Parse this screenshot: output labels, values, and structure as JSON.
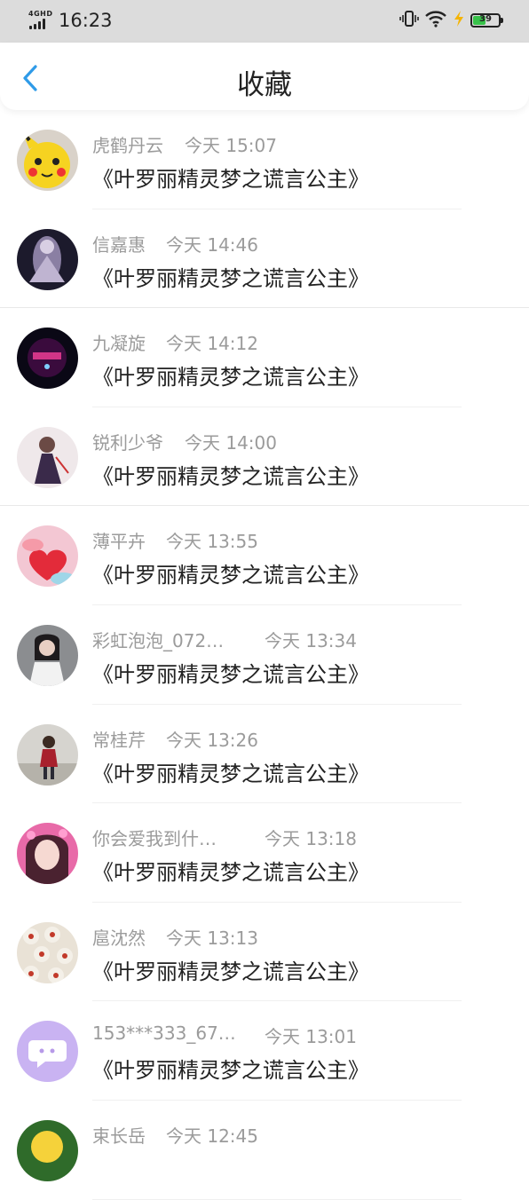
{
  "status_bar": {
    "network": "4GHD",
    "time": "16:23",
    "battery": "39",
    "icons": [
      "signal-icon",
      "vibrate-icon",
      "wifi-icon",
      "charging-icon",
      "battery-icon"
    ]
  },
  "header": {
    "title": "收藏",
    "back_icon": "chevron-left-icon",
    "accent_color": "#2f9be8"
  },
  "items": [
    {
      "name": "虎鹤丹云",
      "time": "今天 15:07",
      "book": "《叶罗丽精灵梦之谎言公主》"
    },
    {
      "name": "信嘉惠",
      "time": "今天 14:46",
      "book": "《叶罗丽精灵梦之谎言公主》"
    },
    {
      "name": "九凝旋",
      "time": "今天 14:12",
      "book": "《叶罗丽精灵梦之谎言公主》"
    },
    {
      "name": "锐利少爷",
      "time": "今天 14:00",
      "book": "《叶罗丽精灵梦之谎言公主》"
    },
    {
      "name": "薄平卉",
      "time": "今天 13:55",
      "book": "《叶罗丽精灵梦之谎言公主》"
    },
    {
      "name": "彩虹泡泡_072…",
      "time": "今天 13:34",
      "book": "《叶罗丽精灵梦之谎言公主》"
    },
    {
      "name": "常桂芹",
      "time": "今天 13:26",
      "book": "《叶罗丽精灵梦之谎言公主》"
    },
    {
      "name": "你会爱我到什…",
      "time": "今天 13:18",
      "book": "《叶罗丽精灵梦之谎言公主》"
    },
    {
      "name": "扈沈然",
      "time": "今天 13:13",
      "book": "《叶罗丽精灵梦之谎言公主》"
    },
    {
      "name": "153***333_67…",
      "time": "今天 13:01",
      "book": "《叶罗丽精灵梦之谎言公主》"
    },
    {
      "name": "束长岳",
      "time": "今天 12:45",
      "book": ""
    }
  ]
}
